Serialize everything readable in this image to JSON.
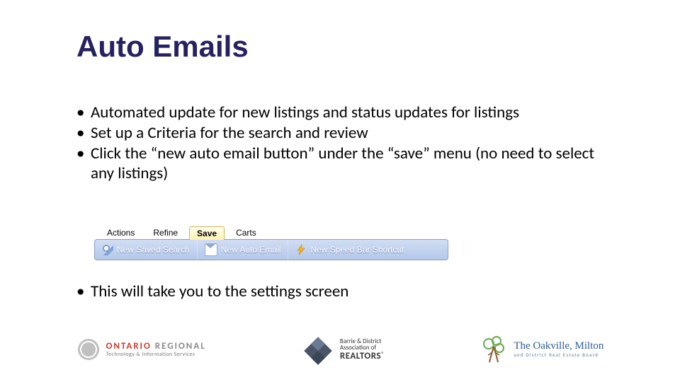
{
  "title": "Auto Emails",
  "bullets": [
    "Automated update for new listings and status updates for listings",
    "Set up a Criteria for the search and review",
    "Click the “new auto email button” under the “save” menu (no need to select any listings)"
  ],
  "after_image_bullet": "This will take you to the settings screen",
  "toolbar": {
    "tabs": [
      "Actions",
      "Refine",
      "Save",
      "Carts"
    ],
    "active_tab_index": 2,
    "buttons": [
      {
        "name": "new-saved-search-button",
        "icon": "search-icon",
        "label": "New Saved Search"
      },
      {
        "name": "new-auto-email-button",
        "icon": "email-icon",
        "label": "New Auto Email"
      },
      {
        "name": "new-speed-bar-shortcut-button",
        "icon": "bolt-icon",
        "label": "New Speed Bar Shortcut"
      }
    ]
  },
  "footer_logos": {
    "ontario_regional": {
      "line1_a": "ONTARIO",
      "line1_b": " REGIONAL",
      "line2": "Technology & Information Services"
    },
    "barrie_district": {
      "line1": "Barrie & District",
      "line2": "Association of",
      "line3": "REALTORS"
    },
    "oakville_milton": {
      "line1": "The Oakville, Milton",
      "line2": "and District Real Estate Board"
    }
  }
}
